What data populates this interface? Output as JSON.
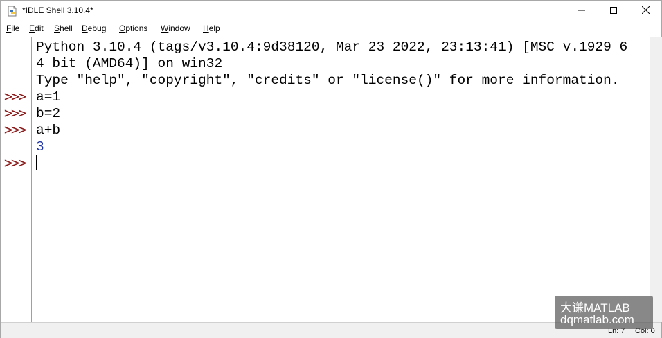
{
  "window": {
    "title": "*IDLE Shell 3.10.4*"
  },
  "menu": [
    "File",
    "Edit",
    "Shell",
    "Debug",
    "Options",
    "Window",
    "Help"
  ],
  "shell": {
    "banner": [
      "Python 3.10.4 (tags/v3.10.4:9d38120, Mar 23 2022, 23:13:41) [MSC v.1929 6",
      "4 bit (AMD64)] on win32",
      "Type \"help\", \"copyright\", \"credits\" or \"license()\" for more information."
    ],
    "prompt": ">>>",
    "entries": [
      {
        "input": "a=1"
      },
      {
        "input": "b=2"
      },
      {
        "input": "a+b",
        "output": "3"
      }
    ]
  },
  "status": {
    "line": "Ln: 7",
    "col": "Col: 0"
  },
  "watermark": {
    "line1": "大谦MATLAB",
    "line2": "dqmatlab.com"
  },
  "colors": {
    "prompt": "#8b1a1a",
    "output": "#1a2fa5"
  }
}
